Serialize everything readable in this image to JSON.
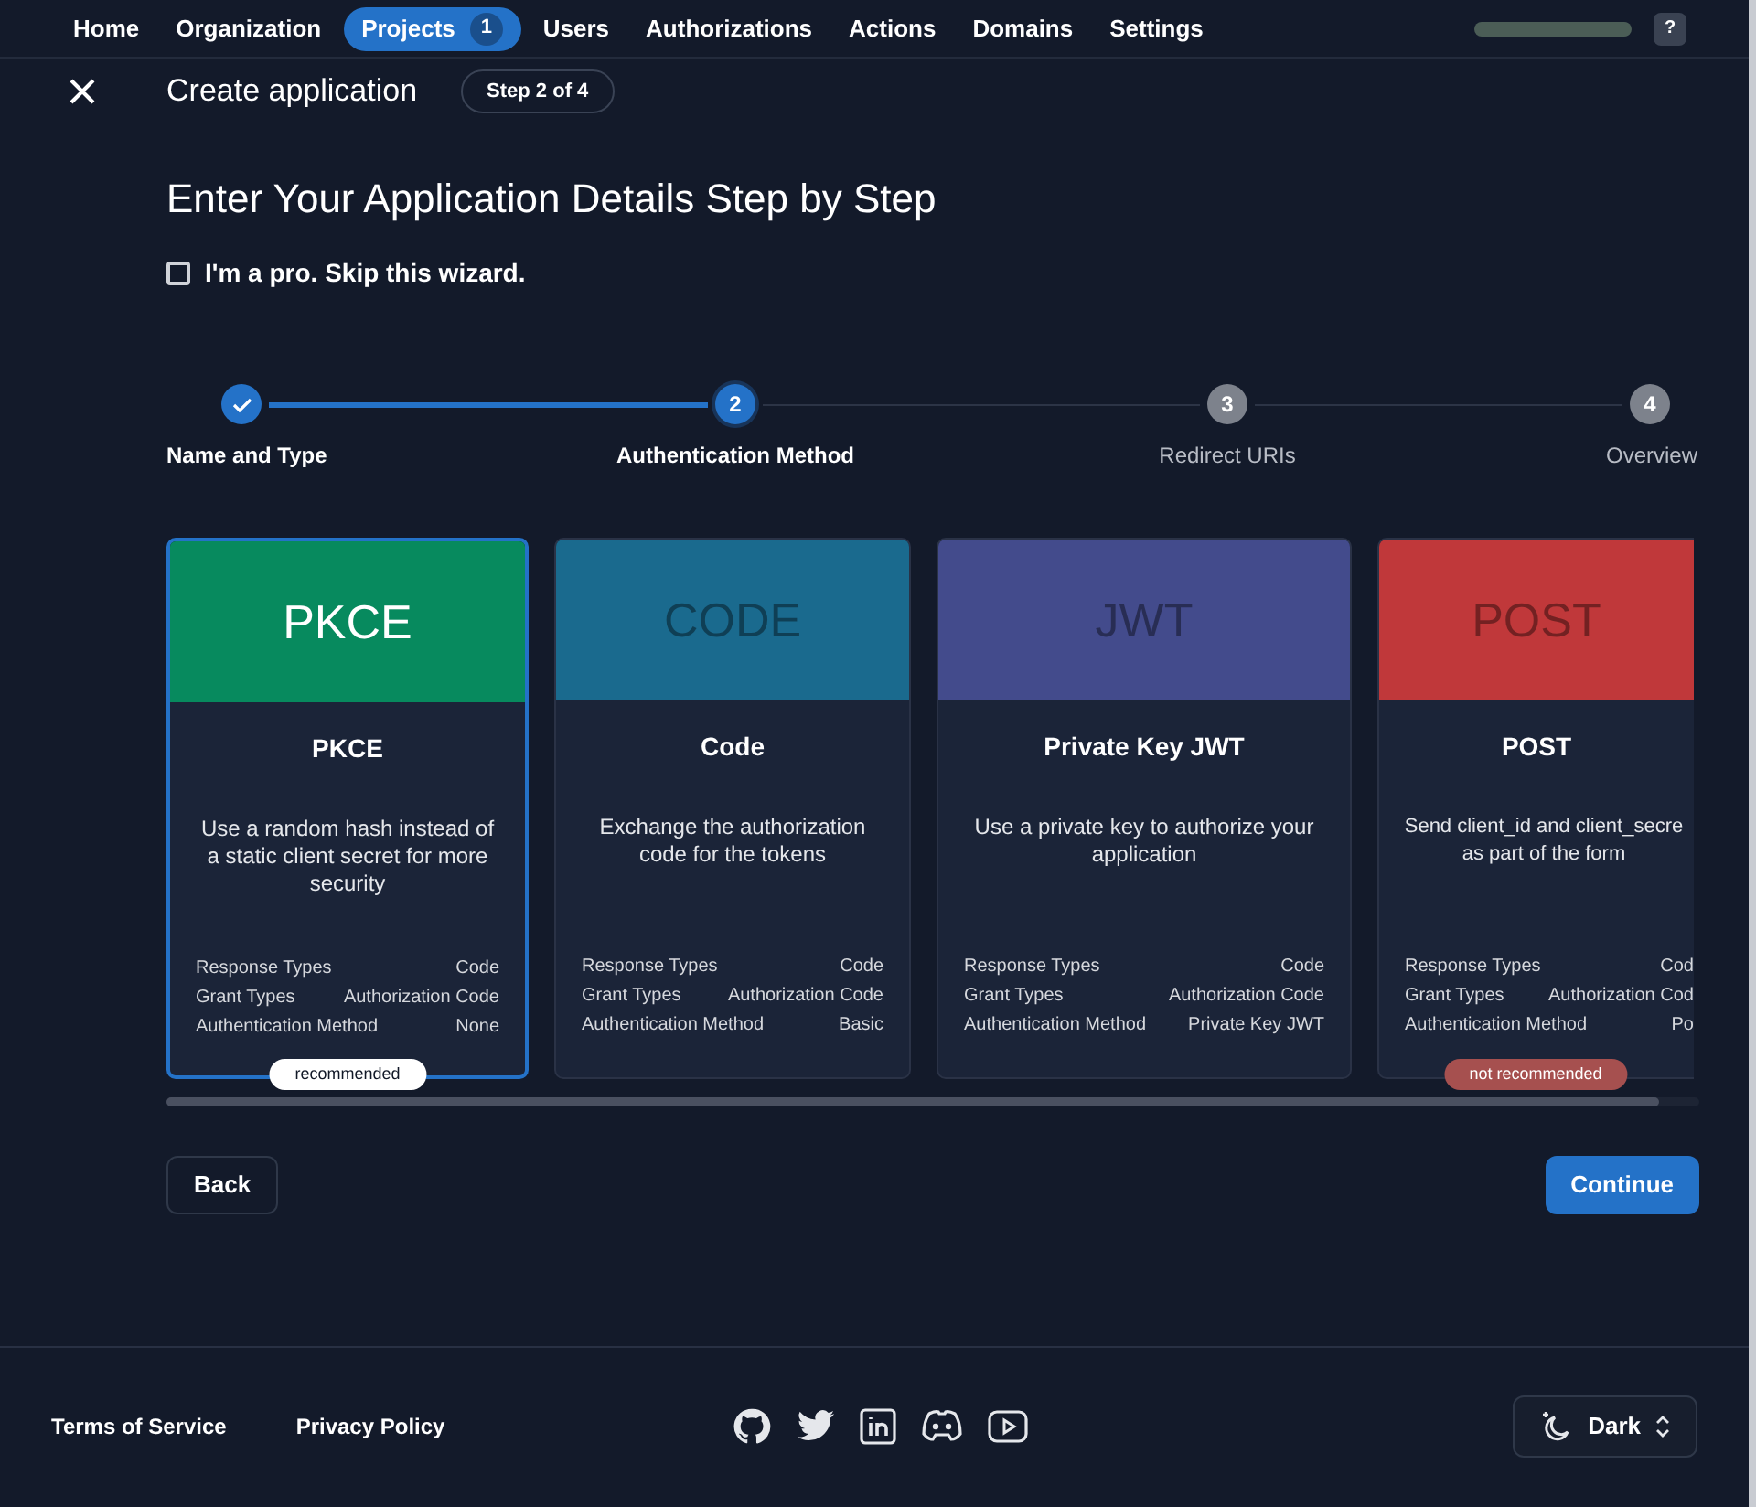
{
  "nav": {
    "items": [
      {
        "label": "Home",
        "selected": false
      },
      {
        "label": "Organization",
        "selected": false
      },
      {
        "label": "Projects",
        "selected": true,
        "count": "1"
      },
      {
        "label": "Users",
        "selected": false
      },
      {
        "label": "Authorizations",
        "selected": false
      },
      {
        "label": "Actions",
        "selected": false
      },
      {
        "label": "Domains",
        "selected": false
      },
      {
        "label": "Settings",
        "selected": false
      }
    ],
    "help": "?"
  },
  "header": {
    "title": "Create application",
    "step": "Step 2 of 4"
  },
  "heading": "Enter Your Application Details Step by Step",
  "skip_wizard": {
    "label": "I'm a pro. Skip this wizard.",
    "checked": false
  },
  "stepper": [
    {
      "label": "Name and Type",
      "completed": true,
      "selected": false
    },
    {
      "label": "Authentication Method",
      "completed": false,
      "selected": true,
      "number": "2"
    },
    {
      "label": "Redirect URIs",
      "completed": false,
      "selected": false,
      "number": "3"
    },
    {
      "label": "Overview",
      "completed": false,
      "selected": false,
      "number": "4"
    }
  ],
  "methods": [
    {
      "banner": "PKCE",
      "color": "#078a5e",
      "title": "PKCE",
      "description": "Use a random hash instead of a static client secret for more security",
      "selected": true,
      "badge": {
        "kind": "recommended",
        "label": "recommended"
      },
      "details": [
        [
          "Response Types",
          "Code"
        ],
        [
          "Grant Types",
          "Authorization Code"
        ],
        [
          "Authentication Method",
          "None"
        ]
      ]
    },
    {
      "banner": "CODE",
      "color": "#1a6a8e",
      "title": "Code",
      "description": "Exchange the authorization code for the tokens",
      "selected": false,
      "details": [
        [
          "Response Types",
          "Code"
        ],
        [
          "Grant Types",
          "Authorization Code"
        ],
        [
          "Authentication Method",
          "Basic"
        ]
      ]
    },
    {
      "banner": "JWT",
      "color": "#434b8c",
      "title": "Private Key JWT",
      "description": "Use a private key to authorize your application",
      "selected": false,
      "details": [
        [
          "Response Types",
          "Code"
        ],
        [
          "Grant Types",
          "Authorization Code"
        ],
        [
          "Authentication Method",
          "Private Key JWT"
        ]
      ]
    },
    {
      "banner": "POST",
      "color": "#c0383a",
      "title": "POST",
      "description": "Send client_id and client_secre as part of the form",
      "selected": false,
      "badge": {
        "kind": "not_recommended",
        "label": "not recommended"
      },
      "details": [
        [
          "Response Types",
          "Cod"
        ],
        [
          "Grant Types",
          "Authorization Cod"
        ],
        [
          "Authentication Method",
          "Po"
        ]
      ]
    }
  ],
  "buttons": {
    "back": "Back",
    "continue": "Continue"
  },
  "footer": {
    "links": [
      "Terms of Service",
      "Privacy Policy"
    ],
    "theme": "Dark"
  }
}
